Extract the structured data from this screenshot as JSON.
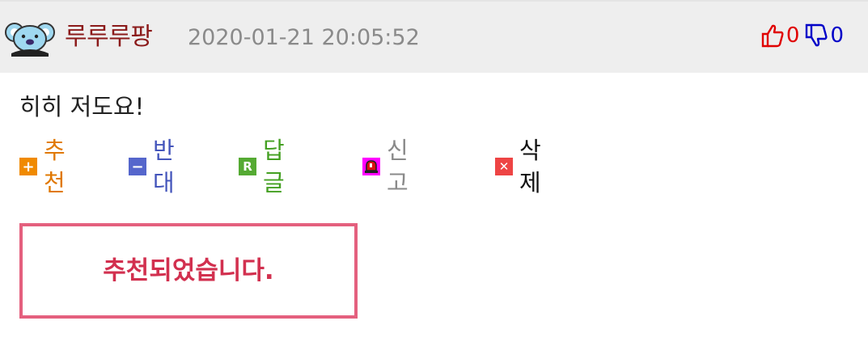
{
  "comment": {
    "author": "루루루팡",
    "timestamp": "2020-01-21 20:05:52",
    "likes": "0",
    "dislikes": "0",
    "body": "히히 저도요!",
    "actions": {
      "recommend": "추천",
      "oppose": "반대",
      "reply": "답글",
      "report": "신고",
      "delete": "삭제"
    },
    "notice": "추천되었습니다."
  },
  "icons": {
    "avatar": "koala-avatar-icon",
    "thumbs_up": "thumbs-up-icon",
    "thumbs_down": "thumbs-down-icon",
    "recommend": "plus-icon",
    "oppose": "minus-icon",
    "reply": "reply-r-icon",
    "report": "siren-icon",
    "delete": "close-icon"
  },
  "colors": {
    "header_bg": "#eeeeee",
    "author": "#8b1a1a",
    "timestamp": "#8a8a8a",
    "likes": "#e00000",
    "dislikes": "#0000c8",
    "recommend": "#e07800",
    "oppose": "#4455bb",
    "reply": "#44a022",
    "report": "#8a8a8a",
    "delete": "#111111",
    "notice_border": "#e4607e",
    "notice_text": "#d2304f"
  }
}
